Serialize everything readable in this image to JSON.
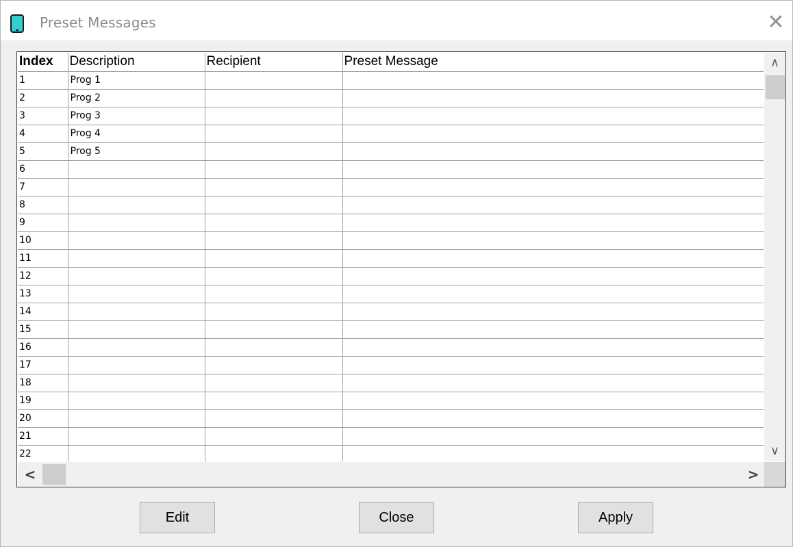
{
  "window": {
    "title": "Preset Messages",
    "close_glyph": "✕",
    "icon": "tablet-icon"
  },
  "grid": {
    "columns": [
      "Index",
      "Description",
      "Recipient",
      "Preset Message"
    ],
    "rows": [
      {
        "index": "1",
        "description": "Prog 1",
        "recipient": "",
        "message": ""
      },
      {
        "index": "2",
        "description": "Prog 2",
        "recipient": "",
        "message": ""
      },
      {
        "index": "3",
        "description": "Prog 3",
        "recipient": "",
        "message": ""
      },
      {
        "index": "4",
        "description": "Prog 4",
        "recipient": "",
        "message": ""
      },
      {
        "index": "5",
        "description": "Prog 5",
        "recipient": "",
        "message": ""
      },
      {
        "index": "6",
        "description": "",
        "recipient": "",
        "message": ""
      },
      {
        "index": "7",
        "description": "",
        "recipient": "",
        "message": ""
      },
      {
        "index": "8",
        "description": "",
        "recipient": "",
        "message": ""
      },
      {
        "index": "9",
        "description": "",
        "recipient": "",
        "message": ""
      },
      {
        "index": "10",
        "description": "",
        "recipient": "",
        "message": ""
      },
      {
        "index": "11",
        "description": "",
        "recipient": "",
        "message": ""
      },
      {
        "index": "12",
        "description": "",
        "recipient": "",
        "message": ""
      },
      {
        "index": "13",
        "description": "",
        "recipient": "",
        "message": ""
      },
      {
        "index": "14",
        "description": "",
        "recipient": "",
        "message": ""
      },
      {
        "index": "15",
        "description": "",
        "recipient": "",
        "message": ""
      },
      {
        "index": "16",
        "description": "",
        "recipient": "",
        "message": ""
      },
      {
        "index": "17",
        "description": "",
        "recipient": "",
        "message": ""
      },
      {
        "index": "18",
        "description": "",
        "recipient": "",
        "message": ""
      },
      {
        "index": "19",
        "description": "",
        "recipient": "",
        "message": ""
      },
      {
        "index": "20",
        "description": "",
        "recipient": "",
        "message": ""
      },
      {
        "index": "21",
        "description": "",
        "recipient": "",
        "message": ""
      },
      {
        "index": "22",
        "description": "",
        "recipient": "",
        "message": ""
      }
    ]
  },
  "scrollbars": {
    "up_glyph": "∧",
    "down_glyph": "∨",
    "left_glyph": "<",
    "right_glyph": ">"
  },
  "buttons": {
    "edit_label": "Edit",
    "close_label": "Close",
    "apply_label": "Apply"
  },
  "colors": {
    "icon_accent": "#2fd0cd",
    "window_bg": "#f0f0f0",
    "button_bg": "#e1e1e1"
  }
}
